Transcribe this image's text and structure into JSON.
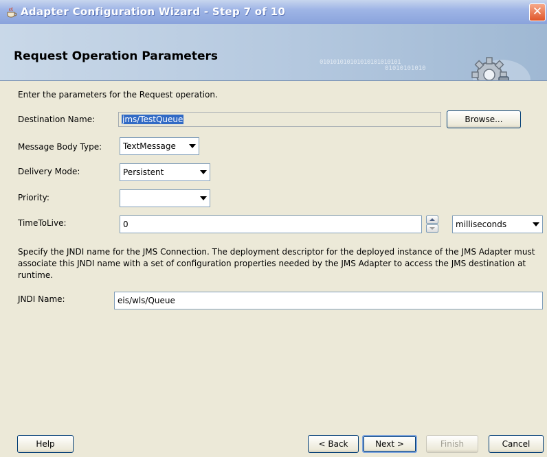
{
  "window": {
    "title": "Adapter Configuration Wizard - Step 7 of 10",
    "close_label": "✕"
  },
  "header": {
    "heading": "Request Operation Parameters",
    "binary_decoration": "010101010101010101010101",
    "binary_decoration_2": "01010101010"
  },
  "form": {
    "intro": "Enter the parameters for the Request operation.",
    "destination_name": {
      "label": "Destination Name:",
      "value": "jms/TestQueue"
    },
    "browse_label": "Browse...",
    "message_body_type": {
      "label": "Message Body Type:",
      "value": "TextMessage"
    },
    "delivery_mode": {
      "label": "Delivery Mode:",
      "value": "Persistent"
    },
    "priority": {
      "label": "Priority:",
      "value": ""
    },
    "time_to_live": {
      "label": "TimeToLive:",
      "value": "0",
      "unit": "milliseconds"
    },
    "jndi_description": "Specify the JNDI name for the JMS Connection.  The deployment descriptor for the deployed instance of the JMS Adapter must associate this JNDI name with a set of configuration properties needed by the JMS Adapter to access the JMS destination at runtime.",
    "jndi_name": {
      "label": "JNDI Name:",
      "value": "eis/wls/Queue"
    }
  },
  "buttons": {
    "help": "Help",
    "back": "< Back",
    "next": "Next >",
    "finish": "Finish",
    "cancel": "Cancel"
  }
}
